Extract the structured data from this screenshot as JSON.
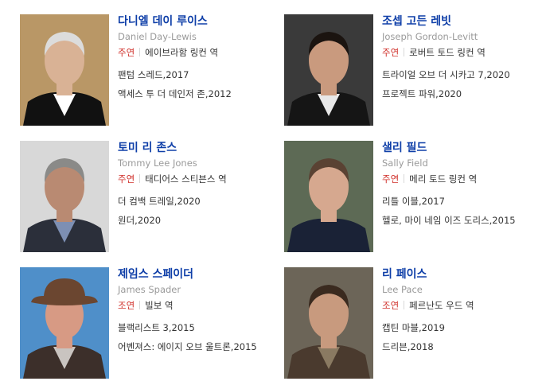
{
  "people": [
    {
      "name": "다니엘 데이 루이스",
      "ename": "Daniel Day-Lewis",
      "role_type": "주연",
      "role": "에이브라함 링컨 역",
      "works": [
        "팬텀 스레드,2017",
        "액세스 투 더 데인저 존,2012"
      ],
      "photo": {
        "bg": "#b99766",
        "skin": "#d9b295",
        "hair": "#dcdcdc",
        "suit": "#111111",
        "shirt": "#ffffff"
      }
    },
    {
      "name": "조셉 고든 레빗",
      "ename": "Joseph Gordon-Levitt",
      "role_type": "주연",
      "role": "로버트 토드 링컨 역",
      "works": [
        "트라이얼 오브 더 시카고 7,2020",
        "프로젝트 파워,2020"
      ],
      "photo": {
        "bg": "#3a3a3a",
        "skin": "#c99a7e",
        "hair": "#1b1410",
        "suit": "#151515",
        "shirt": "#e8e8e8"
      }
    },
    {
      "name": "토미 리 존스",
      "ename": "Tommy Lee Jones",
      "role_type": "주연",
      "role": "태디어스 스티븐스 역",
      "works": [
        "더 컴백 트레일,2020",
        "원더,2020"
      ],
      "photo": {
        "bg": "#d8d8d8",
        "skin": "#b98a72",
        "hair": "#8a8a88",
        "suit": "#2b2f3a",
        "shirt": "#7d8fb3"
      }
    },
    {
      "name": "샐리 필드",
      "ename": "Sally Field",
      "role_type": "주연",
      "role": "메리 토드 링컨 역",
      "works": [
        "리틀 이블,2017",
        "헬로, 마이 네임 이즈 도리스,2015"
      ],
      "photo": {
        "bg": "#5d6a55",
        "skin": "#d6a88f",
        "hair": "#5a4233",
        "suit": "#1a2236",
        "shirt": "#1a2236"
      }
    },
    {
      "name": "제임스 스페이더",
      "ename": "James Spader",
      "role_type": "조연",
      "role": "빌보 역",
      "works": [
        "블랙리스트 3,2015",
        "어벤져스: 에이지 오브 울트론,2015"
      ],
      "photo": {
        "bg": "#4f8fc9",
        "skin": "#d79a84",
        "hair": "#6b4630",
        "suit": "#3c2f2a",
        "shirt": "#c9c4c0"
      }
    },
    {
      "name": "리 페이스",
      "ename": "Lee Pace",
      "role_type": "조연",
      "role": "페르난도 우드 역",
      "works": [
        "캡틴 마블,2019",
        "드리븐,2018"
      ],
      "photo": {
        "bg": "#6c6558",
        "skin": "#c89a7e",
        "hair": "#3a2a1f",
        "suit": "#4a3a2e",
        "shirt": "#8a7a62"
      }
    }
  ]
}
